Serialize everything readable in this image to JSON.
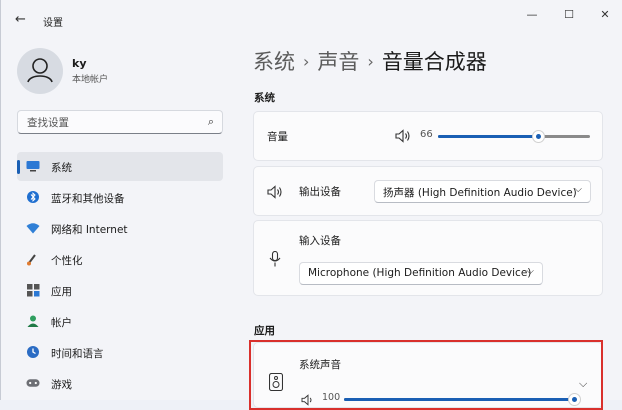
{
  "window": {
    "title": "设置",
    "back": "←",
    "minimize": "—",
    "maximize": "☐",
    "close": "✕"
  },
  "user": {
    "name": "ky",
    "account_type": "本地帐户"
  },
  "search": {
    "placeholder": "查找设置"
  },
  "nav": [
    {
      "label": "系统",
      "icon": "monitor-icon",
      "active": true
    },
    {
      "label": "蓝牙和其他设备",
      "icon": "bluetooth-icon"
    },
    {
      "label": "网络和 Internet",
      "icon": "wifi-icon"
    },
    {
      "label": "个性化",
      "icon": "paintbrush-icon"
    },
    {
      "label": "应用",
      "icon": "apps-icon"
    },
    {
      "label": "帐户",
      "icon": "account-icon"
    },
    {
      "label": "时间和语言",
      "icon": "clock-globe-icon"
    },
    {
      "label": "游戏",
      "icon": "gamepad-icon"
    }
  ],
  "breadcrumb": {
    "level1": "系统",
    "level2": "声音",
    "current": "音量合成器",
    "sep": "›"
  },
  "system_section": {
    "heading": "系统",
    "volume": {
      "label": "音量",
      "value": "66",
      "level": 0.66
    },
    "output": {
      "label": "输出设备",
      "device": "扬声器 (High Definition Audio Device)"
    },
    "input": {
      "label": "输入设备",
      "device": "Microphone (High Definition Audio Device)"
    }
  },
  "apps_section": {
    "heading": "应用",
    "system_sounds": {
      "label": "系统声音",
      "value": "100",
      "level": 1.0
    }
  },
  "colors": {
    "accent": "#1a5fb4",
    "highlight": "#d9302c"
  }
}
